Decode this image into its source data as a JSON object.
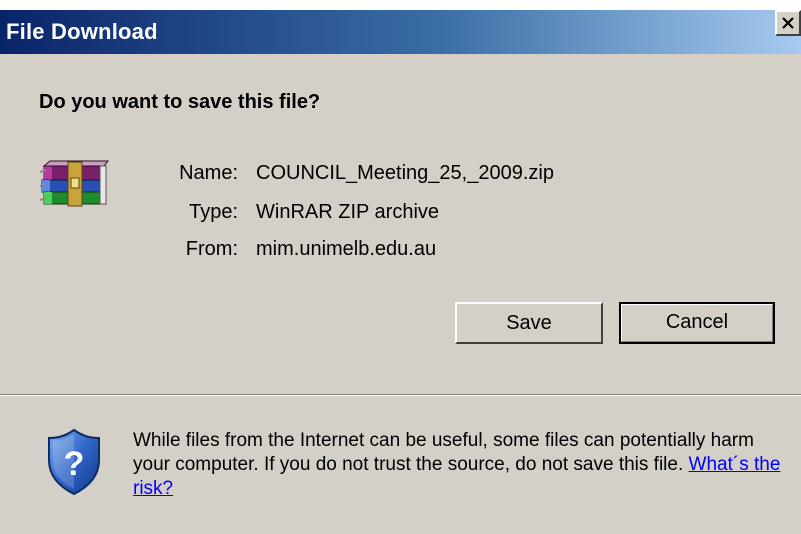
{
  "window": {
    "title": "File Download",
    "close_icon": "close-x-icon"
  },
  "prompt": {
    "question": "Do you want to save this file?"
  },
  "file": {
    "icon": "winrar-archive-icon",
    "name_label": "Name:",
    "name_value": "COUNCIL_Meeting_25,_2009.zip",
    "type_label": "Type:",
    "type_value": "WinRAR ZIP archive",
    "from_label": "From:",
    "from_value": "mim.unimelb.edu.au"
  },
  "buttons": {
    "save_label": "Save",
    "cancel_label": "Cancel"
  },
  "warning": {
    "icon": "security-shield-question-icon",
    "text": "While files from the Internet can be useful, some files can potentially harm your computer. If you do not trust the source, do not save this file.",
    "link_text": "What´s the risk?"
  },
  "colors": {
    "titlebar_start": "#0a246a",
    "titlebar_end": "#a6caf0",
    "dialog_bg": "#d4d0c8",
    "link": "#0000ff"
  }
}
